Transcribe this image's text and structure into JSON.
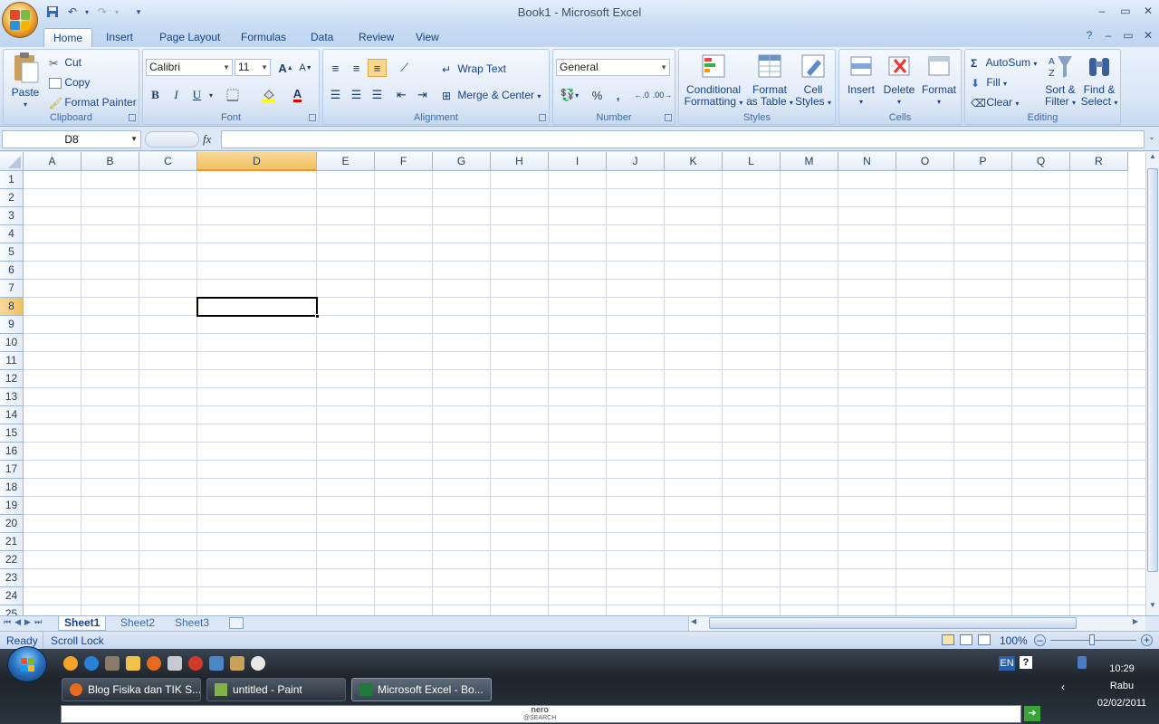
{
  "window": {
    "title": "Book1 - Microsoft Excel"
  },
  "tabs": [
    "Home",
    "Insert",
    "Page Layout",
    "Formulas",
    "Data",
    "Review",
    "View"
  ],
  "active_tab": "Home",
  "clipboard": {
    "paste": "Paste",
    "cut": "Cut",
    "copy": "Copy",
    "format_painter": "Format Painter",
    "label": "Clipboard"
  },
  "font": {
    "name": "Calibri",
    "size": "11",
    "bold": "B",
    "italic": "I",
    "underline": "U",
    "label": "Font",
    "grow": "A",
    "shrink": "A"
  },
  "alignment": {
    "wrap_text": "Wrap Text",
    "merge_center": "Merge & Center",
    "label": "Alignment"
  },
  "number": {
    "format": "General",
    "percent": "%",
    "comma": ",",
    "label": "Number"
  },
  "styles": {
    "conditional": "Conditional",
    "formatting": "Formatting",
    "format": "Format",
    "as_table": "as Table",
    "cell": "Cell",
    "cell_styles": "Styles",
    "label": "Styles"
  },
  "cells": {
    "insert": "Insert",
    "delete": "Delete",
    "format": "Format",
    "label": "Cells"
  },
  "editing": {
    "autosum": "AutoSum",
    "fill": "Fill",
    "clear": "Clear",
    "sort": "Sort &",
    "filter": "Filter",
    "find": "Find &",
    "select": "Select",
    "label": "Editing"
  },
  "formula_bar": {
    "name_box": "D8",
    "fx": "fx",
    "value": ""
  },
  "columns": [
    "A",
    "B",
    "C",
    "D",
    "E",
    "F",
    "G",
    "H",
    "I",
    "J",
    "K",
    "L",
    "M",
    "N",
    "O",
    "P",
    "Q",
    "R"
  ],
  "rows": [
    "1",
    "2",
    "3",
    "4",
    "5",
    "6",
    "7",
    "8",
    "9",
    "10",
    "11",
    "12",
    "13",
    "14",
    "15",
    "16",
    "17",
    "18",
    "19",
    "20",
    "21",
    "22",
    "23",
    "24",
    "25"
  ],
  "active_cell": {
    "col": "D",
    "row": "8"
  },
  "sheets": [
    "Sheet1",
    "Sheet2",
    "Sheet3"
  ],
  "active_sheet": "Sheet1",
  "status": {
    "ready": "Ready",
    "scroll_lock": "Scroll Lock",
    "zoom": "100%"
  },
  "taskbar": {
    "tasks": [
      "Blog Fisika dan TIK S...",
      "untitled - Paint",
      "Microsoft Excel - Bo..."
    ],
    "language": "EN",
    "time": "10:29",
    "day": "Rabu",
    "date": "02/02/2011",
    "nero": "nero",
    "nero_sub": "@SEARCH"
  },
  "colors": {
    "accent": "#15428b",
    "selected_header": "#f1c15f",
    "grid_line": "#d0d7e5"
  }
}
